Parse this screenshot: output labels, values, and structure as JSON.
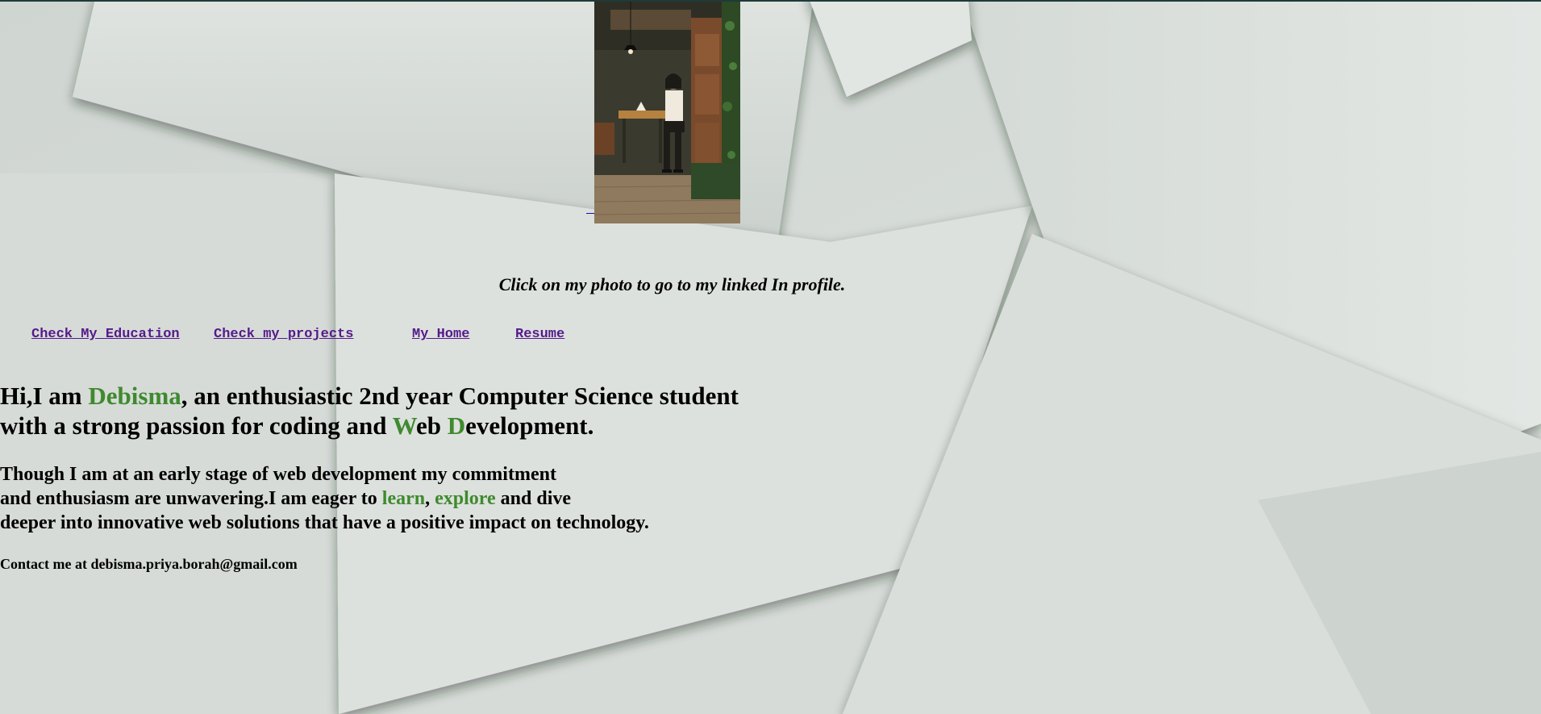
{
  "caption": "Click on my photo to go to my linked In profile.",
  "nav": {
    "education": "Check My Education",
    "projects": "Check my projects",
    "home": "My Home",
    "resume": "Resume"
  },
  "intro": {
    "part1": "Hi,I am ",
    "name": "Debisma",
    "part2": ", an enthusiastic 2nd year Computer Science student",
    "part3": "with a strong passion for coding and ",
    "w": "W",
    "eb": "eb ",
    "d": "D",
    "evelopment": "evelopment."
  },
  "about": {
    "line1": "Though I am at an early stage of web development my commitment",
    "line2a": "and enthusiasm are unwavering.I am eager to ",
    "learn": "learn",
    "comma": ", ",
    "explore": "explore",
    "line2b": " and dive",
    "line3": "deeper into innovative web solutions that have a positive impact on technology."
  },
  "contact": "Contact me at debisma.priya.borah@gmail.com",
  "colors": {
    "accent_green": "#3f8a2e",
    "visited_link": "#551a8b",
    "background": "#d9dedb"
  }
}
